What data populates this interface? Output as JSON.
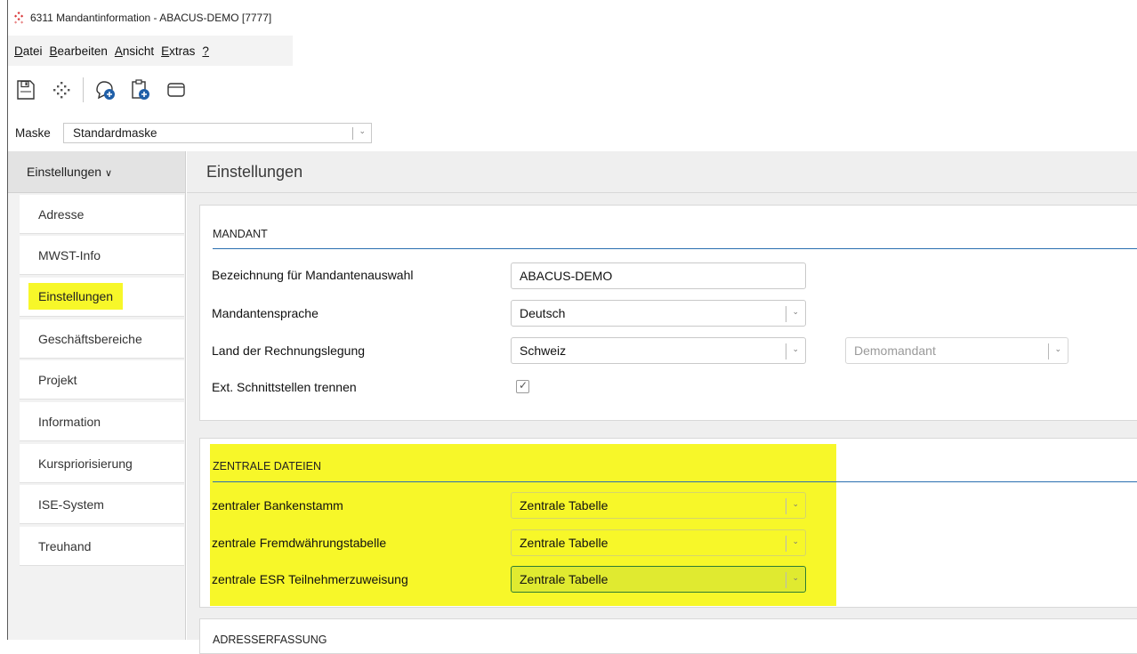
{
  "window": {
    "title": "6311 Mandantinformation - ABACUS-DEMO [7777]"
  },
  "menu": [
    {
      "first": "D",
      "rest": "atei"
    },
    {
      "first": "B",
      "rest": "earbeiten"
    },
    {
      "first": "A",
      "rest": "nsicht"
    },
    {
      "first": "E",
      "rest": "xtras"
    },
    {
      "first": "?",
      "rest": ""
    }
  ],
  "toolbar": {
    "icons": [
      "save-icon",
      "network-icon",
      "add-comment-icon",
      "add-clipboard-icon",
      "window-icon"
    ]
  },
  "maske": {
    "label": "Maske",
    "value": "Standardmaske"
  },
  "sidebar": {
    "header": "Einstellungen",
    "items": [
      {
        "label": "Adresse"
      },
      {
        "label": "MWST-Info"
      },
      {
        "label": "Einstellungen",
        "active": true
      },
      {
        "label": "Geschäftsbereiche"
      },
      {
        "label": "Projekt"
      },
      {
        "label": "Information"
      },
      {
        "label": "Kurspriorisierung"
      },
      {
        "label": "ISE-System"
      },
      {
        "label": "Treuhand"
      }
    ]
  },
  "main": {
    "title": "Einstellungen",
    "mandant": {
      "heading": "MANDANT",
      "bezeichnung_label": "Bezeichnung für Mandantenauswahl",
      "bezeichnung_value": "ABACUS-DEMO",
      "sprache_label": "Mandantensprache",
      "sprache_value": "Deutsch",
      "land_label": "Land der Rechnungslegung",
      "land_value": "Schweiz",
      "land_extra_value": "Demomandant",
      "schnitt_label": "Ext. Schnittstellen trennen",
      "schnitt_checked": true
    },
    "zentrale": {
      "heading": "ZENTRALE DATEIEN",
      "rows": [
        {
          "label": "zentraler Bankenstamm",
          "value": "Zentrale Tabelle"
        },
        {
          "label": "zentrale Fremdwährungstabelle",
          "value": "Zentrale Tabelle"
        },
        {
          "label": "zentrale ESR Teilnehmerzuweisung",
          "value": "Zentrale Tabelle"
        }
      ]
    },
    "next_heading": "ADRESSERFASSUNG"
  },
  "colors": {
    "highlight": "#f7f729",
    "accent": "#2a6fb0",
    "focus": "#2e7d32"
  }
}
